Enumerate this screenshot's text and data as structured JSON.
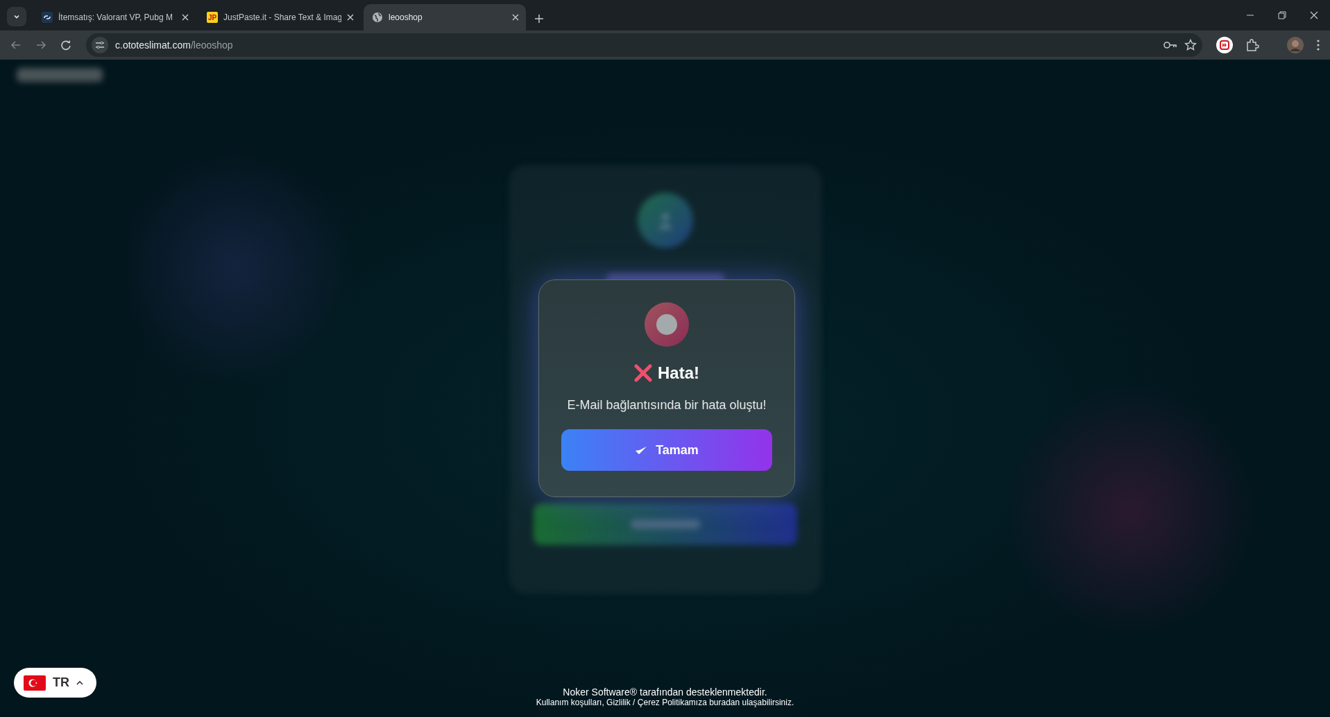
{
  "browser": {
    "tabs": [
      {
        "title": "İtemsatış: Valorant VP, Pubg M",
        "kind": "link",
        "selected": false
      },
      {
        "title": "JustPaste.it - Share Text & Imag",
        "kind": "lettered",
        "favicon_text": "JP",
        "selected": false
      },
      {
        "title": "leooshop",
        "kind": "globe",
        "selected": true
      }
    ],
    "url": {
      "host": "c.ototeslimat.com",
      "path": "/leooshop"
    }
  },
  "page": {
    "dialog": {
      "title": "Hata!",
      "message": "E-Mail bağlantısında bir hata oluştu!",
      "button": "Tamam"
    },
    "language": {
      "code": "TR"
    },
    "footer": [
      "Noker Software® tarafından desteklenmektedir.",
      "Kullanım koşulları, Gizlilik / Çerez Politikamıza buradan ulaşabilirsiniz."
    ]
  }
}
